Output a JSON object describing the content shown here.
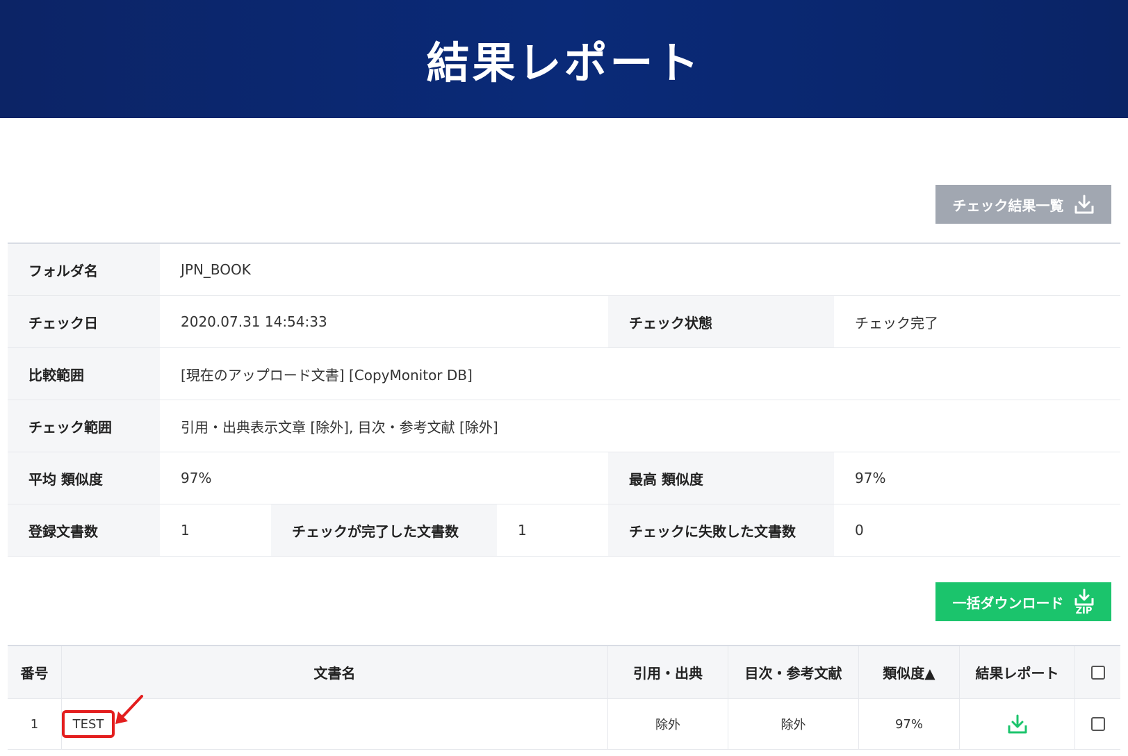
{
  "header": {
    "title": "結果レポート"
  },
  "buttons": {
    "check_results_list": "チェック結果一覧",
    "bulk_download": "一括ダウンロード",
    "bulk_download_badge": "ZIP"
  },
  "info": {
    "folder_label": "フォルダ名",
    "folder_value": "JPN_BOOK",
    "check_date_label": "チェック日",
    "check_date_value": "2020.07.31 14:54:33",
    "check_status_label": "チェック状態",
    "check_status_value": "チェック完了",
    "compare_range_label": "比較範囲",
    "compare_range_value": "[現在のアップロード文書] [CopyMonitor DB]",
    "check_range_label": "チェック範囲",
    "check_range_value": "引用・出典表示文章 [除外], 目次・参考文献 [除外]",
    "avg_similarity_label": "平均 類似度",
    "avg_similarity_value": "97%",
    "max_similarity_label": "最高 類似度",
    "max_similarity_value": "97%",
    "registered_docs_label": "登録文書数",
    "registered_docs_value": "1",
    "completed_docs_label": "チェックが完了した文書数",
    "completed_docs_value": "1",
    "failed_docs_label": "チェックに失敗した文書数",
    "failed_docs_value": "0"
  },
  "table": {
    "headers": {
      "number": "番号",
      "doc_name": "文書名",
      "citation": "引用・出典",
      "toc_refs": "目次・参考文献",
      "similarity": "類似度▲",
      "report": "結果レポート"
    },
    "rows": [
      {
        "number": "1",
        "doc_name": "TEST",
        "citation": "除外",
        "toc_refs": "除外",
        "similarity": "97%"
      }
    ]
  },
  "colors": {
    "header_bg": "#0a2a78",
    "green": "#1bc46c",
    "gray_button": "#a1a7b1",
    "highlight": "#e31e1e"
  },
  "icons": [
    "download-icon",
    "download-zip-icon",
    "checkbox",
    "red-arrow-annotation"
  ]
}
